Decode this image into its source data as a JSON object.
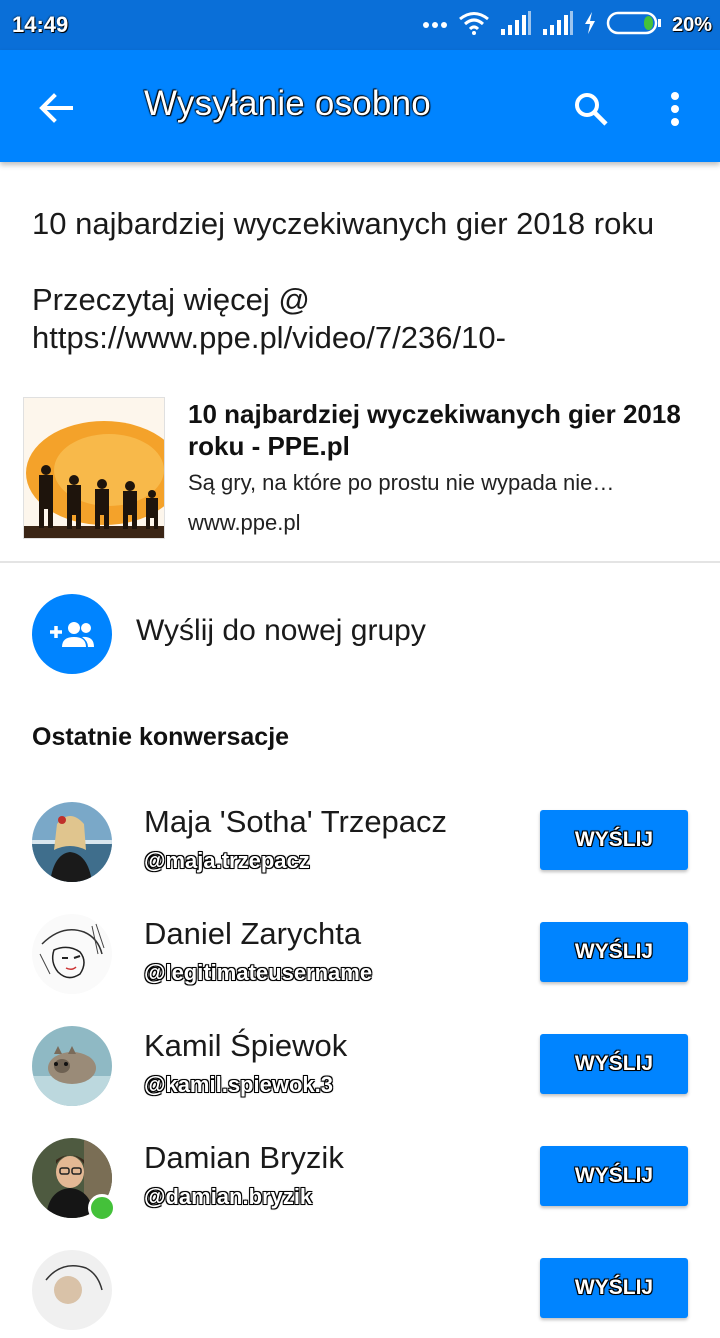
{
  "status_bar": {
    "time": "14:49",
    "battery": "20%"
  },
  "app_bar": {
    "title": "Wysyłanie osobno"
  },
  "message": {
    "headline": "10 najbardziej wyczekiwanych gier 2018 roku",
    "read_more": "Przeczytaj więcej @",
    "url": "https://www.ppe.pl/video/7/236/10-"
  },
  "link_preview": {
    "title": "10 najbardziej wyczekiwanych gier 2018 roku - PPE.pl",
    "description": "Są gry, na które po prostu nie wypada nie…",
    "domain": "www.ppe.pl"
  },
  "new_group": {
    "label": "Wyślij do nowej grupy"
  },
  "recent": {
    "heading": "Ostatnie konwersacje",
    "contacts": [
      {
        "name": "Maja 'Sotha' Trzepacz",
        "handle": "@maja.trzepacz",
        "button": "WYŚLIJ"
      },
      {
        "name": "Daniel Zarychta",
        "handle": "@legitimateusername",
        "button": "WYŚLIJ"
      },
      {
        "name": "Kamil Śpiewok",
        "handle": "@kamil.spiewok.3",
        "button": "WYŚLIJ"
      },
      {
        "name": "Damian Bryzik",
        "handle": "@damian.bryzik",
        "button": "WYŚLIJ"
      },
      {
        "name": "",
        "handle": "",
        "button": "WYŚLIJ"
      }
    ]
  },
  "colors": {
    "accent": "#0084ff",
    "status_bar": "#0a6fd8",
    "online": "#44c13a"
  }
}
